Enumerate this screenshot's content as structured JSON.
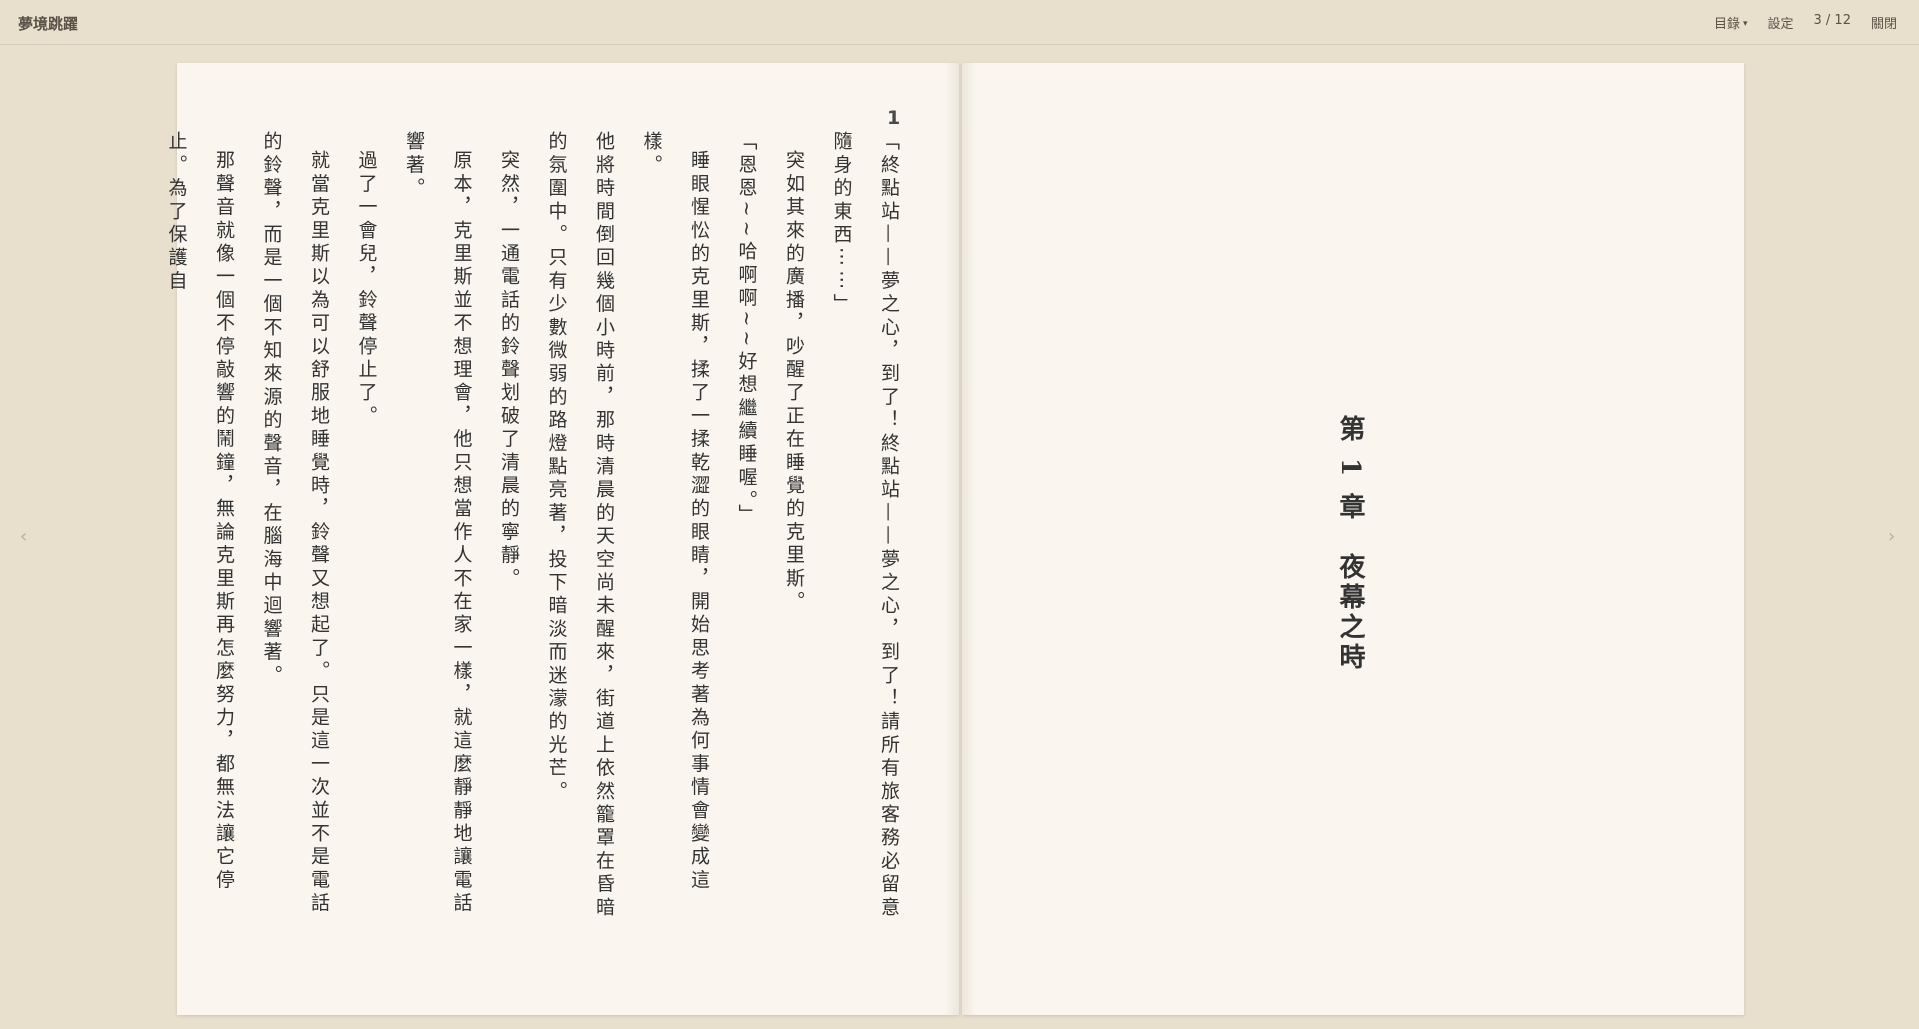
{
  "app": {
    "title": "夢境跳躍"
  },
  "toolbar": {
    "toc_label": "目錄",
    "settings_label": "設定",
    "page_indicator": "3 / 12",
    "close_label": "關閉"
  },
  "nav": {
    "prev_glyph": "‹",
    "next_glyph": "›"
  },
  "left_page": {
    "page_number": "1",
    "paragraphs": [
      "「終點站——夢之心，到了！終點站——夢之心，到了！請所有旅客務必留意隨身的東西⋯⋯」",
      "突如其來的廣播，吵醒了正在睡覺的克里斯。",
      "「恩恩∼∼哈啊啊∼∼好想繼續睡喔。」",
      "睡眼惺忪的克里斯，揉了一揉乾澀的眼睛，開始思考著為何事情會變成這樣。",
      "他將時間倒回幾個小時前，那時清晨的天空尚未醒來，街道上依然籠罩在昏暗的氛圍中。只有少數微弱的路燈點亮著，投下暗淡而迷濛的光芒。",
      "突然，一通電話的鈴聲划破了清晨的寧靜。",
      "原本，克里斯並不想理會，他只想當作人不在家一樣，就這麼靜靜地讓電話響著。",
      "過了一會兒，鈴聲停止了。",
      "就當克里斯以為可以舒服地睡覺時，鈴聲又想起了。只是這一次並不是電話的鈴聲，而是一個不知來源的聲音，在腦海中迴響著。",
      "那聲音就像一個不停敲響的鬧鐘，無論克里斯再怎麼努力，都無法讓它停止。為了保護自"
    ]
  },
  "right_page": {
    "chapter_title": "第 1 章　夜幕之時"
  }
}
